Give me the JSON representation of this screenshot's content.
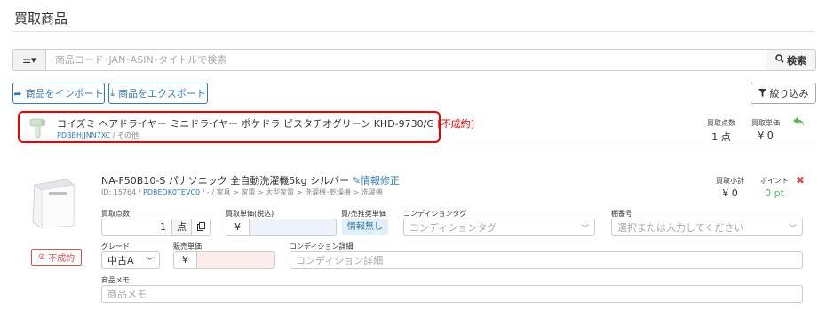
{
  "page": {
    "title": "買取商品"
  },
  "search": {
    "placeholder": "商品コード･JAN･ASIN･タイトルで検索",
    "button_label": "検索",
    "filter_icon": "sliders-caret"
  },
  "actions": {
    "import_label": "商品をインポート",
    "export_label": "商品をエクスポート",
    "filter_label": "絞り込み"
  },
  "item1": {
    "name": "コイズミ ヘアドライヤー ミニドライヤー ポケドラ ピスタチオグリーン KHD-9730/G",
    "status_tag": "[不成約]",
    "code": "PDBBHJJNN7XC",
    "category": " / その他",
    "qty_label": "買取点数",
    "qty_value": "1 点",
    "price_label": "買取単価",
    "price_value": "¥ 0"
  },
  "item2": {
    "name": "NA-F50B10-S パナソニック 全自動洗濯機5kg シルバー",
    "edit_link": "情報修正",
    "id_text": "ID: 15764 / ",
    "code": "PDBEDK0TEVC0",
    "path": " / - / 家具 > 家電 > 大型家電 > 洗濯機･乾燥機 > 洗濯機",
    "subtotal_label": "買取小計",
    "subtotal_value": "¥ 0",
    "points_label": "ポイント",
    "points_value": "0 pt",
    "qty_field_label": "買取点数",
    "qty_value": "1",
    "qty_unit": "点",
    "buy_price_label": "買取単価(税込)",
    "yen": "¥",
    "suggested_label": "買/売推奨単価",
    "suggested_value": "情報無し",
    "condition_tag_label": "コンディションタグ",
    "condition_tag_placeholder": "コンディションタグ",
    "shelf_label": "棚番号",
    "shelf_placeholder": "選択または入力してください",
    "grade_label": "グレード",
    "grade_value": "中古A",
    "sell_price_label": "販売単価",
    "condition_detail_label": "コンディション詳細",
    "condition_detail_placeholder": "コンディション詳細",
    "memo_label": "商品メモ",
    "memo_placeholder": "商品メモ",
    "ng_button": "不成約"
  },
  "colors": {
    "accent": "#337ab7",
    "danger": "#e00000",
    "success": "#5cb85c"
  }
}
